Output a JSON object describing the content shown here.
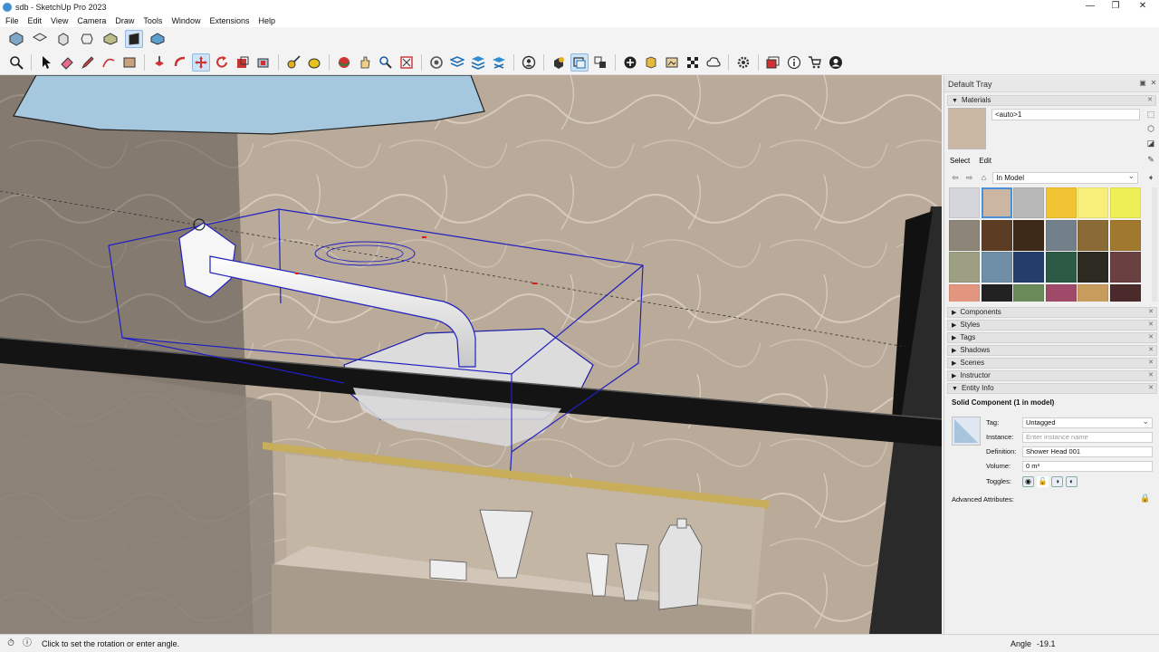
{
  "window": {
    "title": "sdb - SketchUp Pro 2023"
  },
  "menubar": {
    "items": [
      "File",
      "Edit",
      "View",
      "Camera",
      "Draw",
      "Tools",
      "Window",
      "Extensions",
      "Help"
    ]
  },
  "toolbar_views": [
    "iso-view-icon",
    "top-view-icon",
    "front-view-icon",
    "right-view-icon",
    "back-view-icon",
    "left-view-icon",
    "bottom-view-icon"
  ],
  "tray": {
    "title": "Default Tray",
    "materials": {
      "header": "Materials",
      "current_name": "<auto>1",
      "tab_select": "Select",
      "tab_edit": "Edit",
      "collection": "In Model",
      "swatch_colors": [
        "#d5d5dc",
        "#cbb6a3",
        "#b8b8b8",
        "#f2c332",
        "#f7ef7a",
        "#eeee55",
        "#8e8579",
        "#5c3d23",
        "#3d2918",
        "#748089",
        "#8a6a35",
        "#a0792f",
        "#9d9f82",
        "#6f8fa9",
        "#233e6a",
        "#2c5a45",
        "#2d2a22",
        "#6a4040",
        "#e3967f",
        "#222222",
        "#6a8a5a",
        "#a04a6a",
        "#c79c5c",
        "#4a2a2a"
      ]
    },
    "sections": [
      "Components",
      "Styles",
      "Tags",
      "Shadows",
      "Scenes",
      "Instructor"
    ],
    "entity_info": {
      "header": "Entity Info",
      "title": "Solid Component (1 in model)",
      "tag_label": "Tag:",
      "tag_value": "Untagged",
      "instance_label": "Instance:",
      "instance_placeholder": "Enter instance name",
      "definition_label": "Definition:",
      "definition_value": "Shower Head 001",
      "volume_label": "Volume:",
      "volume_value": "0 m³",
      "toggles_label": "Toggles:",
      "advanced_label": "Advanced Attributes:"
    }
  },
  "status": {
    "message": "Click to set the rotation or enter angle.",
    "measure_label": "Angle",
    "measure_value": "-19.1"
  }
}
